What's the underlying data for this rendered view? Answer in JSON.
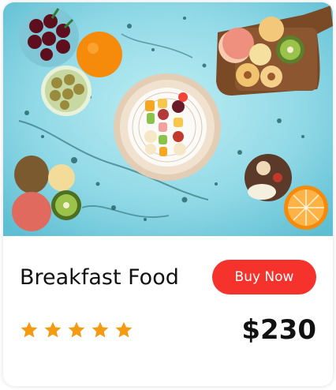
{
  "card": {
    "title": "Breakfast Food",
    "buy_label": "Buy Now",
    "price": "$230",
    "rating": 5,
    "rating_max": 5
  },
  "image": {
    "subject": "fruit-skewers-plate-photo",
    "icon": "food-photo"
  },
  "colors": {
    "accent": "#f5332c",
    "star": "#f59a13",
    "text": "#111111",
    "backdrop": "#9fdde8"
  }
}
